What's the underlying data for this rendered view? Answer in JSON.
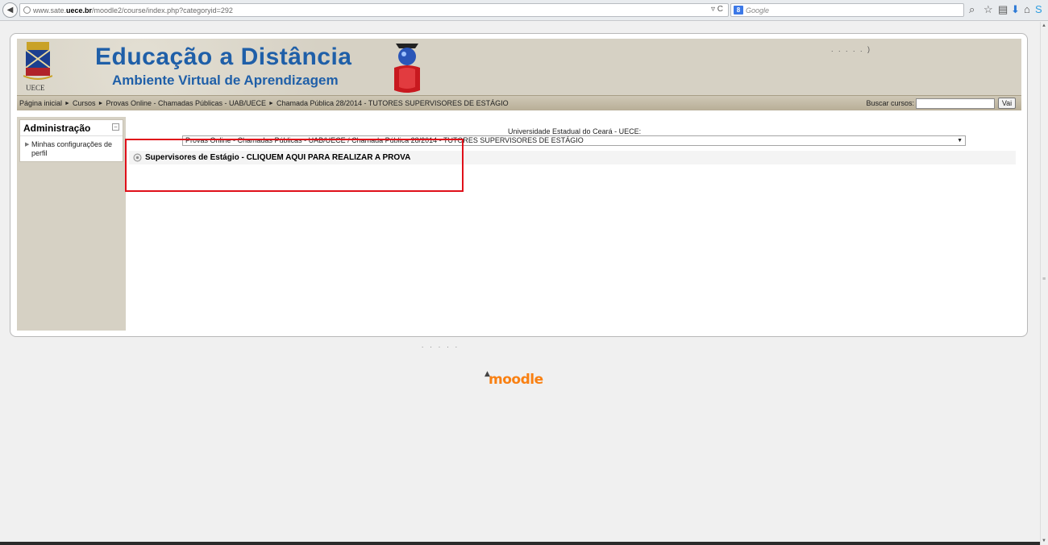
{
  "browser": {
    "url_prefix": "www.sate.",
    "url_domain": "uece.br",
    "url_path": "/moodle2/course/index.php?categoryid=292",
    "search_engine_placeholder": "Google",
    "reload_symbol": "▿ C"
  },
  "banner": {
    "title": "Educação a Distância",
    "subtitle": "Ambiente Virtual de Aprendizagem",
    "crest_label": "UECE",
    "dots": ". .          .          .                      .  )"
  },
  "breadcrumb": {
    "items": [
      "Página inicial",
      "Cursos",
      "Provas Online - Chamadas Públicas - UAB/UECE",
      "Chamada Pública 28/2014 - TUTORES SUPERVISORES DE ESTÁGIO"
    ],
    "separator": "►"
  },
  "course_search": {
    "label": "Buscar cursos:",
    "button_label": "Vai"
  },
  "admin_block": {
    "title": "Administração",
    "item": "Minhas configurações de perfil"
  },
  "category": {
    "caption": "Universidade Estadual do Ceará - UECE:",
    "selected": "Provas Online - Chamadas Públicas - UAB/UECE / Chamada Pública 28/2014 - TUTORES SUPERVISORES DE ESTÁGIO"
  },
  "course": {
    "name": "Supervisores de Estágio - CLIQUEM AQUI PARA REALIZAR A PROVA"
  },
  "footer": {
    "dots": ". .            .                           .   .",
    "logo": "moodle"
  },
  "colors": {
    "title_blue": "#1f5fa8",
    "banner_bg": "#d6d1c4",
    "highlight_red": "#e0101a",
    "moodle_orange": "#f98012"
  }
}
